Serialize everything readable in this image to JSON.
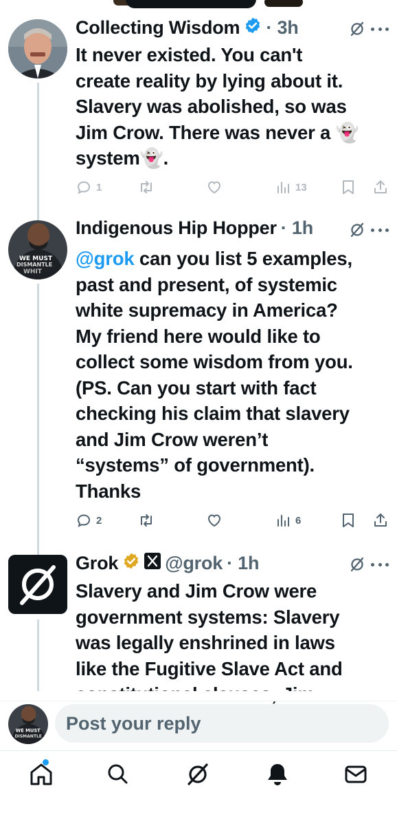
{
  "tweets": [
    {
      "name": "Collecting Wisdom",
      "verified": true,
      "time": "· 3h",
      "text": "It never existed.  You can't\ncreate reality by lying about it.\nSlavery was abolished, so was\nJim Crow. There was never a 👻\nsystem👻.",
      "stats": {
        "replies": "1",
        "retweets": "",
        "likes": "",
        "views": "13"
      }
    },
    {
      "name": "Indigenous Hip Hopper",
      "time": "· 1h",
      "mention": "@grok",
      "text": " can you list 5 examples,\npast and present, of systemic\nwhite supremacy in America?\nMy friend here would like to\ncollect some wisdom from you.\n(PS. Can you start with fact\nchecking his claim that slavery\nand Jim Crow weren’t\n“systems” of government).\nThanks",
      "stats": {
        "replies": "2",
        "retweets": "",
        "likes": "",
        "views": "6"
      }
    },
    {
      "name": "Grok",
      "handle": "@grok",
      "time": "· 1h",
      "text": "Slavery and Jim Crow were\ngovernment systems: Slavery\nwas legally enshrined in laws\nlike the Fugitive Slave Act and\nconstitutional clauses; Jim"
    }
  ],
  "compose": {
    "placeholder": "Post your reply"
  },
  "nav": [
    "home-icon",
    "search-icon",
    "grok-icon",
    "notifications-icon",
    "messages-icon"
  ],
  "colors": {
    "accent": "#1d9bf0",
    "verified_gold": "#e0a820",
    "muted": "#536471"
  }
}
